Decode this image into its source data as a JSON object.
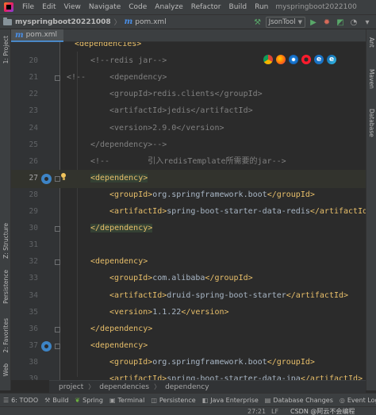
{
  "menubar": {
    "items": [
      "File",
      "Edit",
      "View",
      "Navigate",
      "Code",
      "Analyze",
      "Refactor",
      "Build",
      "Run"
    ],
    "project_title": "myspringboot2022100"
  },
  "navbar": {
    "project": "myspringboot20221008",
    "file": "pom.xml",
    "run_config": "JsonTool"
  },
  "tab": {
    "label": "pom.xml"
  },
  "side_tabs": {
    "left_top": "1: Project",
    "left_structure": "Z: Structure",
    "left_persistence": "Persistence",
    "left_favorites": "2: Favorites",
    "left_web": "Web",
    "right_ant": "Ant",
    "right_maven": "Maven",
    "right_database": "Database"
  },
  "editor": {
    "lines": [
      {
        "n": "",
        "parts": [
          {
            "c": "tag",
            "t": "<dependencies>"
          }
        ]
      },
      {
        "n": "20",
        "parts": [
          {
            "c": "cmt",
            "t": "<!--redis jar-->"
          }
        ]
      },
      {
        "n": "21",
        "parts": [
          {
            "c": "cmt",
            "t": "<!--     <dependency>"
          }
        ]
      },
      {
        "n": "22",
        "parts": [
          {
            "c": "cmt",
            "t": "<groupId>redis.clients</groupId>"
          }
        ]
      },
      {
        "n": "23",
        "parts": [
          {
            "c": "cmt",
            "t": "<artifactId>jedis</artifactId>"
          }
        ]
      },
      {
        "n": "24",
        "parts": [
          {
            "c": "cmt",
            "t": "<version>2.9.0</version>"
          }
        ]
      },
      {
        "n": "25",
        "parts": [
          {
            "c": "cmt",
            "t": "</dependency>-->"
          }
        ]
      },
      {
        "n": "26",
        "parts": [
          {
            "c": "cmt",
            "t": "<!--        引入redisTemplate所需要的jar-->"
          }
        ]
      },
      {
        "n": "27",
        "parts": [
          {
            "c": "tag",
            "t": "<dependency>"
          }
        ]
      },
      {
        "n": "28",
        "parts": [
          {
            "c": "tag",
            "t": "<groupId>"
          },
          {
            "c": "text",
            "t": "org.springframework.boot"
          },
          {
            "c": "tag",
            "t": "</groupId>"
          }
        ]
      },
      {
        "n": "29",
        "parts": [
          {
            "c": "tag",
            "t": "<artifactId>"
          },
          {
            "c": "text",
            "t": "spring-boot-starter-data-redis"
          },
          {
            "c": "tag",
            "t": "</artifactId>"
          }
        ]
      },
      {
        "n": "30",
        "parts": [
          {
            "c": "tag",
            "t": "</dependency>"
          }
        ]
      },
      {
        "n": "31",
        "parts": []
      },
      {
        "n": "32",
        "parts": [
          {
            "c": "tag",
            "t": "<dependency>"
          }
        ]
      },
      {
        "n": "33",
        "parts": [
          {
            "c": "tag",
            "t": "<groupId>"
          },
          {
            "c": "text",
            "t": "com.alibaba"
          },
          {
            "c": "tag",
            "t": "</groupId>"
          }
        ]
      },
      {
        "n": "34",
        "parts": [
          {
            "c": "tag",
            "t": "<artifactId>"
          },
          {
            "c": "text",
            "t": "druid-spring-boot-starter"
          },
          {
            "c": "tag",
            "t": "</artifactId>"
          }
        ]
      },
      {
        "n": "35",
        "parts": [
          {
            "c": "tag",
            "t": "<version>"
          },
          {
            "c": "text",
            "t": "1.1.22"
          },
          {
            "c": "tag",
            "t": "</version>"
          }
        ]
      },
      {
        "n": "36",
        "parts": [
          {
            "c": "tag",
            "t": "</dependency>"
          }
        ]
      },
      {
        "n": "37",
        "parts": [
          {
            "c": "tag",
            "t": "<dependency>"
          }
        ]
      },
      {
        "n": "38",
        "parts": [
          {
            "c": "tag",
            "t": "<groupId>"
          },
          {
            "c": "text",
            "t": "org.springframework.boot"
          },
          {
            "c": "tag",
            "t": "</groupId>"
          }
        ]
      },
      {
        "n": "39",
        "parts": [
          {
            "c": "tag",
            "t": "<artifactId>"
          },
          {
            "c": "text",
            "t": "spring-boot-starter-data-jpa"
          },
          {
            "c": "tag",
            "t": "</artifactId>"
          }
        ]
      }
    ]
  },
  "breadcrumbs": [
    "project",
    "dependencies",
    "dependency"
  ],
  "bottom_tools": [
    "6: TODO",
    "Build",
    "Spring",
    "Terminal",
    "Persistence",
    "Java Enterprise",
    "Database Changes",
    "Event Log"
  ],
  "status": {
    "position": "27:21",
    "lf": "LF",
    "watermark": "CSDN @阿云不会编程"
  },
  "colors": {
    "editor_bg": "#2b2b2b",
    "tag": "#e8bf6a",
    "comment": "#808080",
    "text": "#a9b7c6",
    "accent": "#4a88c7"
  }
}
